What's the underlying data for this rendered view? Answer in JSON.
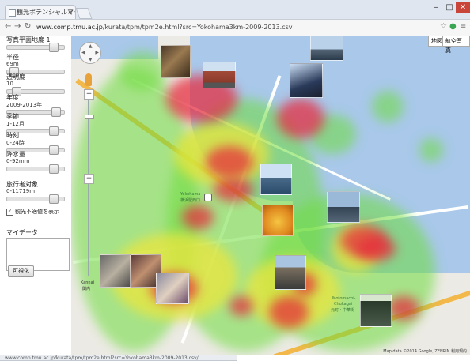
{
  "browser": {
    "tab_title": "観光ポテンシャルマップ - 横浜",
    "tab_close": "×",
    "url_host": "www.comp.tmu.ac.jp",
    "url_path": "/kurata/tpm/tpm2e.html?src=Yokohama3km-2009-2013.csv",
    "status_url": "www.comp.tmu.ac.jp/kurata/tpm/tpm2e.html?src=Yokohama3km-2009-2013.csv/"
  },
  "panel": {
    "controls": [
      {
        "label": "写真平面地度 1",
        "sub": "",
        "thumb_fraction": 0.85
      },
      {
        "label": "半径",
        "sub": "69m",
        "thumb_fraction": 0.05
      },
      {
        "label": "透明度",
        "sub": "10",
        "thumb_fraction": 0.1
      },
      {
        "label": "年度",
        "sub": "2009-2013年",
        "thumb_fraction": 0.9
      },
      {
        "label": "季節",
        "sub": "1-12月",
        "thumb_fraction": 0.85
      },
      {
        "label": "時刻",
        "sub": "0-24時",
        "thumb_fraction": 0.85
      },
      {
        "label": "降水量",
        "sub": "0-92mm",
        "thumb_fraction": 0.85
      },
      {
        "label": "旅行者対象",
        "sub": "0-11719m",
        "thumb_fraction": 0.85
      }
    ],
    "checkbox_label": "観光不適値を表示",
    "checkbox_mark": "✓",
    "my_data_label": "マイデータ",
    "apply_button": "可視化"
  },
  "map": {
    "map_type_buttons": [
      "地図",
      "航空写真"
    ],
    "zoom_in": "+",
    "zoom_out": "−",
    "labels": {
      "yokohama_jp": "Yokohama",
      "yokohama_sub": "横浜駅西口",
      "kannai": "Kannai",
      "kannai_jp": "関内",
      "motomachi": "Motomachi-",
      "motomachi2": "Chukagai",
      "motomachi_jp": "元町・中華街"
    },
    "attribution": "Map data ©2014 Google, ZENRIN  利用規約"
  },
  "colors": {
    "heat_green": "#6edc3c",
    "heat_yellow": "#ebe63c",
    "heat_red": "#e6283c",
    "water": "#a9c8ea",
    "window_close": "#c9453a"
  }
}
